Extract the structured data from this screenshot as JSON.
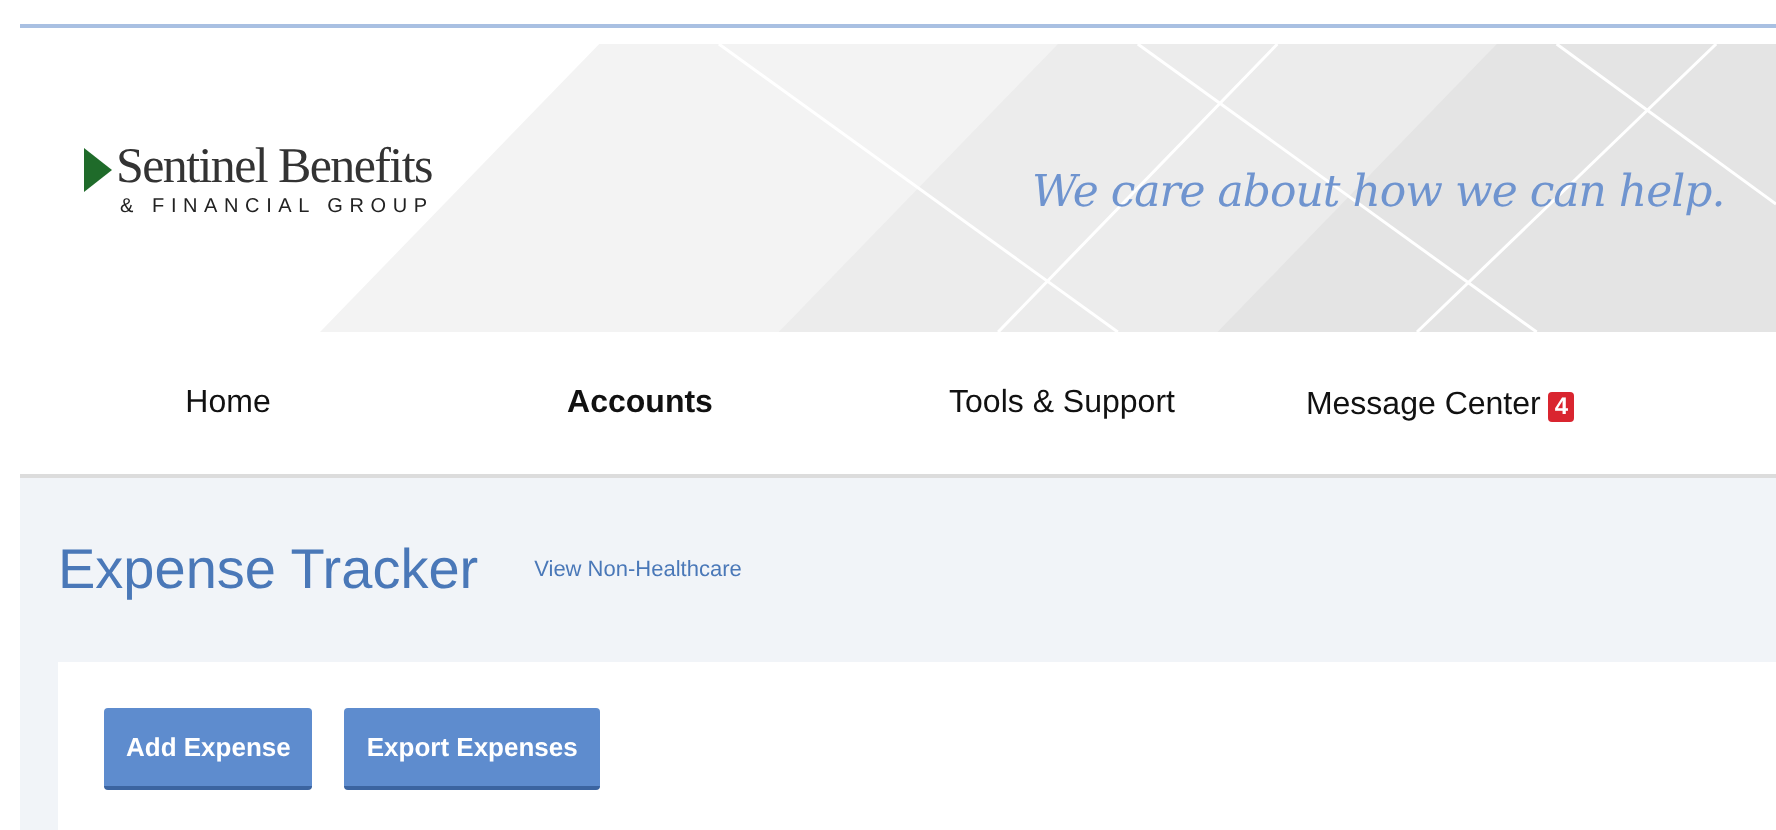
{
  "logo": {
    "name": "Sentinel Benefits",
    "subtitle": "& FINANCIAL GROUP"
  },
  "banner": {
    "tagline": "We care about how we can help."
  },
  "nav": [
    {
      "label": "Home",
      "selected": false
    },
    {
      "label": "Accounts",
      "selected": true
    },
    {
      "label": "Tools & Support",
      "selected": false
    },
    {
      "label": "Message Center",
      "selected": false,
      "badge": "4"
    }
  ],
  "page": {
    "title": "Expense Tracker",
    "link": "View Non-Healthcare"
  },
  "buttons": [
    "Add Expense",
    "Export Expenses"
  ]
}
